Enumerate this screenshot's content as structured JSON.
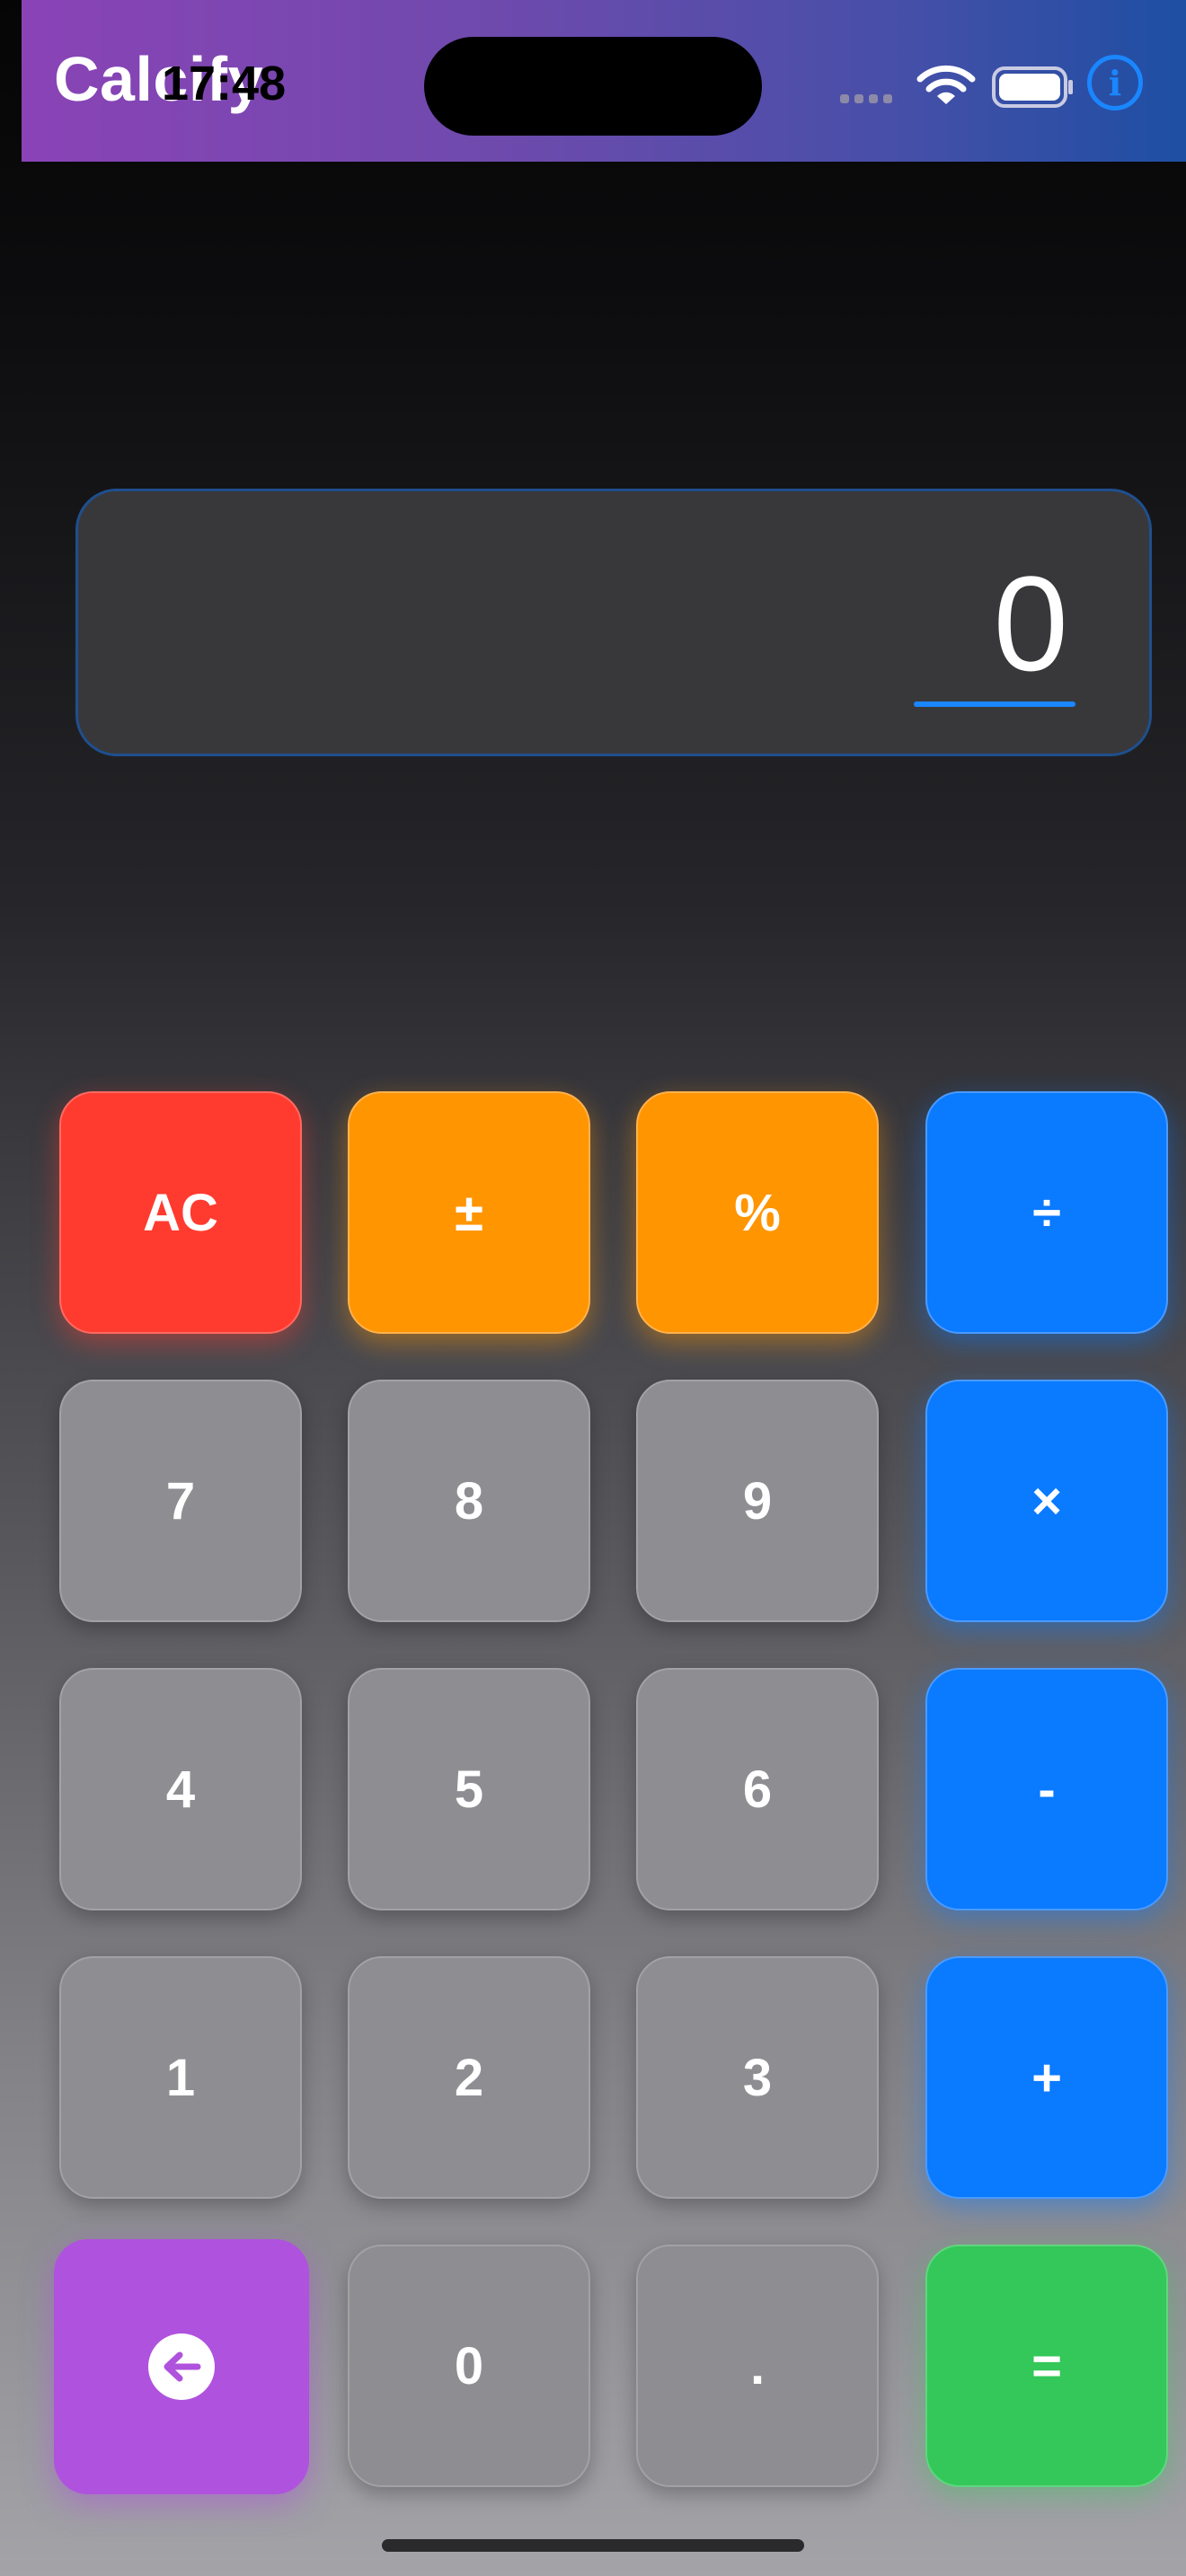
{
  "app": {
    "title": "Calcify"
  },
  "status_bar": {
    "time": "17:48"
  },
  "display": {
    "value": "0"
  },
  "keys": {
    "ac": "AC",
    "plus_minus": "±",
    "percent": "%",
    "divide": "÷",
    "seven": "7",
    "eight": "8",
    "nine": "9",
    "multiply": "×",
    "four": "4",
    "five": "5",
    "six": "6",
    "minus": "-",
    "one": "1",
    "two": "2",
    "three": "3",
    "plus": "+",
    "zero": "0",
    "decimal": ".",
    "equals": "="
  },
  "icons": {
    "info": "info-icon",
    "backspace": "arrow-left-icon",
    "wifi": "wifi-icon",
    "battery": "battery-icon",
    "signal": "cellular-signal-icon"
  },
  "colors": {
    "accent_blue": "#0a7aff",
    "clear_red": "#ff3b30",
    "function_orange": "#ff9500",
    "equals_green": "#34c759",
    "backspace_purple": "#af52de",
    "digit_gray": "#8e8e92"
  }
}
